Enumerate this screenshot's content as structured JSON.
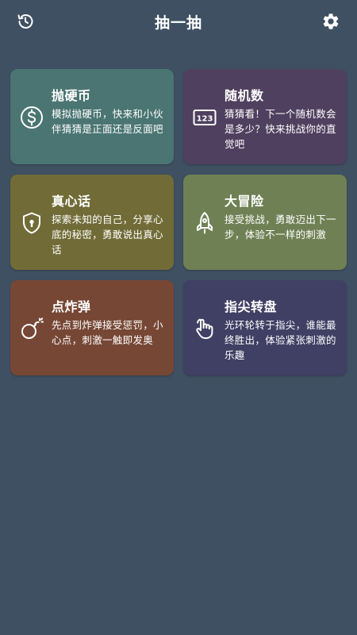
{
  "app": {
    "title": "抽一抽",
    "left_icon": "history-icon",
    "right_icon": "settings-gear-icon"
  },
  "cards": [
    {
      "title": "抛硬币",
      "desc": "模拟抛硬币，快来和小伙伴猜猜是正面还是反面吧",
      "icon": "coin-dollar-icon",
      "color": "#4a7572"
    },
    {
      "title": "随机数",
      "desc": "猜猜看！下一个随机数会是多少？快来挑战你的直觉吧",
      "icon": "number-123-icon",
      "color": "#50405f"
    },
    {
      "title": "真心话",
      "desc": "探索未知的自己，分享心底的秘密，勇敢说出真心话",
      "icon": "shield-lock-icon",
      "color": "#716c37"
    },
    {
      "title": "大冒险",
      "desc": "接受挑战，勇敢迈出下一步，体验不一样的刺激",
      "icon": "rocket-icon",
      "color": "#6f8154"
    },
    {
      "title": "点炸弹",
      "desc": "先点到炸弹接受惩罚，小心点，刺激一触即发奥",
      "icon": "bomb-icon",
      "color": "#774735"
    },
    {
      "title": "指尖转盘",
      "desc": "光环轮转于指尖，谁能最终胜出，体验紧张刺激的乐趣",
      "icon": "hand-touch-icon",
      "color": "#403f64"
    }
  ]
}
